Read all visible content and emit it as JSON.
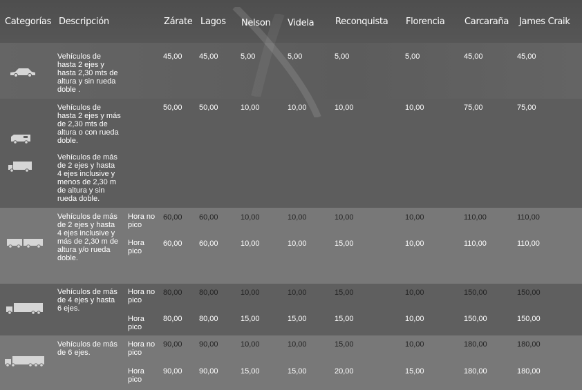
{
  "headers": {
    "categorias": "Categorías",
    "descripcion": "Descripción",
    "cols": [
      "Zárate",
      "Lagos",
      "Nelson",
      "Videla",
      "Reconquista",
      "Florencia",
      "Carcaraña",
      "James Craik"
    ]
  },
  "rows": [
    {
      "icon": "car-icon",
      "desc": "Vehículos de hasta 2 ejes y hasta 2,30 mts de altura y sin rueda doble .",
      "values": [
        "45,00",
        "45,00",
        "5,00",
        "5,00",
        "5,00",
        "5,00",
        "45,00",
        "45,00"
      ]
    },
    {
      "icon": "motorhome-icon",
      "desc": "Vehículos de hasta 2 ejes y más de  2,30 mts de altura o con rueda doble.",
      "values": [
        "50,00",
        "50,00",
        "10,00",
        "10,00",
        "10,00",
        "10,00",
        "75,00",
        "75,00"
      ]
    },
    {
      "icon": "small-truck-icon",
      "desc": "Vehículos de más de 2 ejes y hasta 4 ejes inclusive y menos de 2,30 m de altura y sin rueda doble."
    },
    {
      "icon": "truck-trailer-icon",
      "desc": "Vehículos de más de 2 ejes y hasta 4 ejes inclusive y más de 2,30 m de altura y/o rueda doble.",
      "sub": [
        {
          "label": "Hora no pico",
          "values": [
            "60,00",
            "60,00",
            "10,00",
            "10,00",
            "10,00",
            "10,00",
            "110,00",
            "110,00"
          ]
        },
        {
          "label": "Hora pico",
          "values": [
            "60,00",
            "60,00",
            "10,00",
            "10,00",
            "15,00",
            "10,00",
            "110,00",
            "110,00"
          ]
        }
      ]
    },
    {
      "icon": "box-truck-icon",
      "desc": "Vehículos de más de 4 ejes y hasta 6 ejes.",
      "sub": [
        {
          "label": "Hora no pico",
          "values": [
            "80,00",
            "80,00",
            "10,00",
            "10,00",
            "15,00",
            "10,00",
            "150,00",
            "150,00"
          ]
        },
        {
          "label": "Hora pico",
          "values": [
            "80,00",
            "80,00",
            "15,00",
            "15,00",
            "15,00",
            "10,00",
            "150,00",
            "150,00"
          ]
        }
      ]
    },
    {
      "icon": "semi-truck-icon",
      "desc": "Vehículos de más de 6 ejes.",
      "sub": [
        {
          "label": "Hora no pico",
          "values": [
            "90,00",
            "90,00",
            "10,00",
            "10,00",
            "15,00",
            "10,00",
            "180,00",
            "180,00"
          ]
        },
        {
          "label": "Hora pico",
          "values": [
            "90,00",
            "90,00",
            "15,00",
            "15,00",
            "20,00",
            "15,00",
            "180,00",
            "180,00"
          ]
        }
      ]
    }
  ]
}
